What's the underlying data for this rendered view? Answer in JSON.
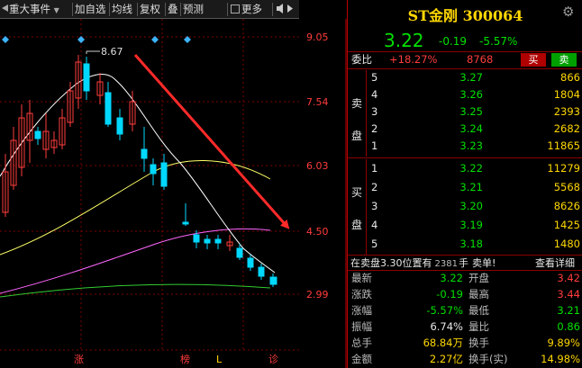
{
  "toolbar": {
    "items": [
      {
        "label": "重大事件",
        "icon": "dropdown-arrow-icon"
      },
      {
        "label": "加自选"
      },
      {
        "label": "均线"
      },
      {
        "label": "复权"
      },
      {
        "label": "叠"
      },
      {
        "label": "预测"
      },
      {
        "label": "更多",
        "icon": "checkbox-icon"
      },
      {
        "icon": "sound-toggle-icon"
      }
    ]
  },
  "chart": {
    "price_axis": [
      "9.05",
      "7.54",
      "6.03",
      "4.50",
      "2.99"
    ],
    "high_marker": "8.67",
    "bottom_markers": [
      {
        "label": "涨",
        "color": "#ff3c3c"
      },
      {
        "label": "榜",
        "color": "#ff3c3c"
      },
      {
        "label": "L",
        "color": "#ffd700"
      },
      {
        "label": "诊",
        "color": "#ff3c3c"
      }
    ],
    "colors": {
      "up": "#ff3c3c",
      "down": "#00d8ff",
      "ma5": "#ffffff",
      "ma10": "#ffff66",
      "ma20": "#ff66ff",
      "ma60": "#33cc33",
      "arrow": "#ff2a2a"
    }
  },
  "quote": {
    "name": "ST金刚",
    "code": "300064",
    "price": "3.22",
    "change": "-0.19",
    "change_pct": "-5.57%",
    "settings_icon": "gear-icon"
  },
  "order_book": {
    "weibi_label": "委比",
    "weibi_value": "+18.27%",
    "weicha_value": "8768",
    "buy_button": "买",
    "sell_button": "卖",
    "sell_side_label": [
      "卖",
      "盘"
    ],
    "buy_side_label": [
      "买",
      "盘"
    ],
    "asks": [
      {
        "level": "5",
        "price": "3.27",
        "volume": "866"
      },
      {
        "level": "4",
        "price": "3.26",
        "volume": "1804"
      },
      {
        "level": "3",
        "price": "3.25",
        "volume": "2393"
      },
      {
        "level": "2",
        "price": "3.24",
        "volume": "2682"
      },
      {
        "level": "1",
        "price": "3.23",
        "volume": "11865"
      }
    ],
    "bids": [
      {
        "level": "1",
        "price": "3.22",
        "volume": "11279"
      },
      {
        "level": "2",
        "price": "3.21",
        "volume": "5568"
      },
      {
        "level": "3",
        "price": "3.20",
        "volume": "8626"
      },
      {
        "level": "4",
        "price": "3.19",
        "volume": "1425"
      },
      {
        "level": "5",
        "price": "3.18",
        "volume": "1480"
      }
    ]
  },
  "sell_info": {
    "prefix": "在卖盘",
    "price": "3.30",
    "middle": "位置有",
    "volume": "2381",
    "unit": "手",
    "suffix": "卖单!",
    "detail_link": "查看详细"
  },
  "stats": [
    {
      "l1": "最新",
      "v1": "3.22",
      "c1": "grn",
      "l2": "开盘",
      "v2": "3.42",
      "c2": "red"
    },
    {
      "l1": "涨跌",
      "v1": "-0.19",
      "c1": "grn",
      "l2": "最高",
      "v2": "3.44",
      "c2": "red"
    },
    {
      "l1": "涨幅",
      "v1": "-5.57%",
      "c1": "grn",
      "l2": "最低",
      "v2": "3.21",
      "c2": "grn"
    },
    {
      "l1": "振幅",
      "v1": "6.74%",
      "c1": "wht",
      "l2": "量比",
      "v2": "0.86",
      "c2": "grn"
    },
    {
      "l1": "总手",
      "v1": "68.84万",
      "c1": "yel",
      "l2": "换手",
      "v2": "9.89%",
      "c2": "yel"
    },
    {
      "l1": "金额",
      "v1": "2.27亿",
      "c1": "yel",
      "l2": "换手(实)",
      "v2": "14.98%",
      "c2": "yel"
    }
  ]
}
